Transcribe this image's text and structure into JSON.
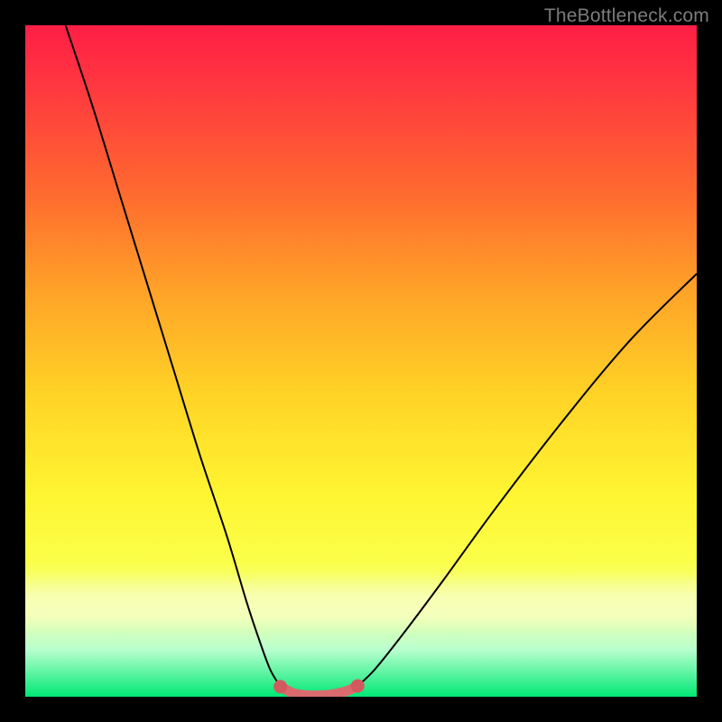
{
  "watermark": "TheBottleneck.com",
  "colors": {
    "curve": "#000000",
    "trough": "#d96b6e",
    "trough_dot": "#d25a5f"
  },
  "chart_data": {
    "type": "line",
    "title": "",
    "xlabel": "",
    "ylabel": "",
    "xlim": [
      0,
      100
    ],
    "ylim": [
      0,
      100
    ],
    "grid": false,
    "legend": false,
    "series": [
      {
        "name": "left-curve",
        "x": [
          6,
          10,
          14,
          18,
          22,
          26,
          30,
          33,
          35,
          36.5,
          38
        ],
        "y": [
          100,
          88,
          75,
          62,
          49,
          36,
          24,
          14,
          8,
          4,
          1.5
        ]
      },
      {
        "name": "trough",
        "x": [
          38,
          40,
          42,
          44,
          46,
          48,
          49.5
        ],
        "y": [
          1.5,
          0.5,
          0.2,
          0.2,
          0.4,
          0.9,
          1.6
        ]
      },
      {
        "name": "right-curve",
        "x": [
          49.5,
          52,
          56,
          62,
          70,
          80,
          90,
          100
        ],
        "y": [
          1.6,
          4,
          9,
          17,
          28,
          41,
          53,
          63
        ]
      }
    ],
    "annotations": [
      {
        "name": "trough-start-dot",
        "x": 38,
        "y": 1.5
      },
      {
        "name": "trough-end-dot",
        "x": 49.5,
        "y": 1.6
      }
    ]
  }
}
